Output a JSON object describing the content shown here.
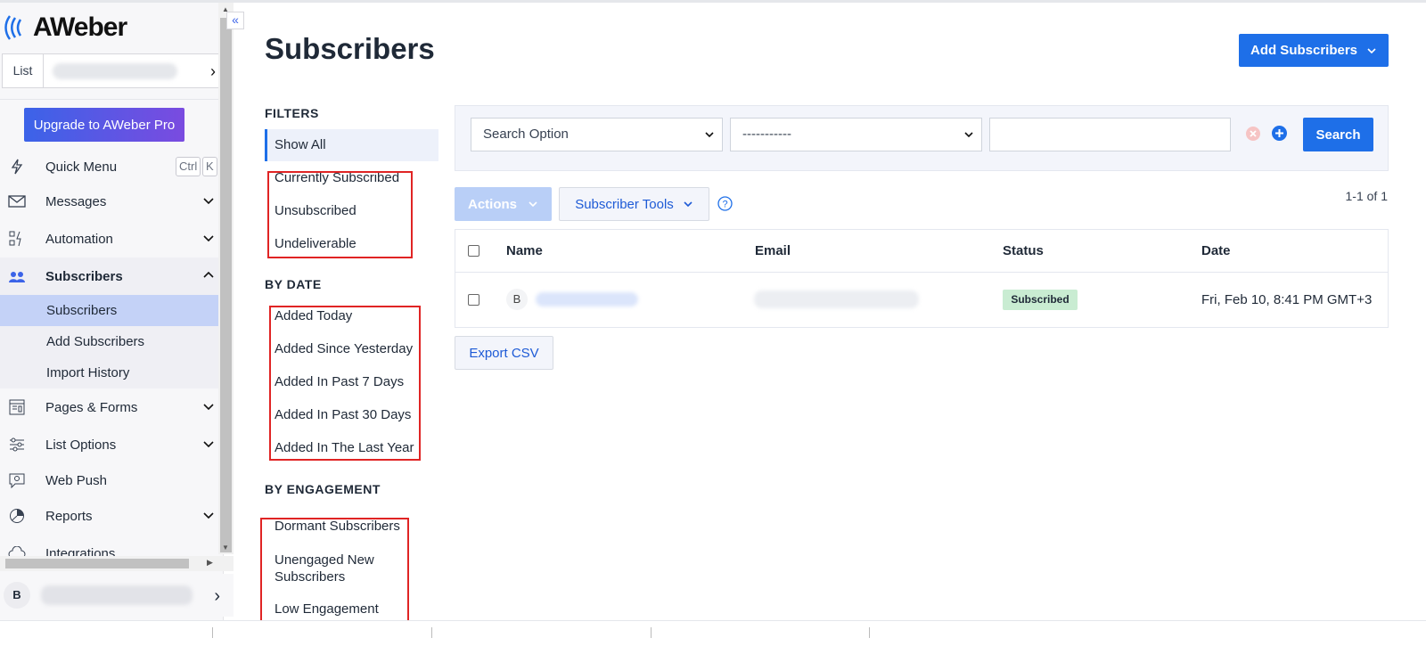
{
  "brand": {
    "logo_text": "AWeber"
  },
  "sidebar": {
    "list_label": "List",
    "upgrade_label": "Upgrade to AWeber Pro",
    "quick_menu": {
      "label": "Quick Menu",
      "kbd1": "Ctrl",
      "kbd2": "K"
    },
    "items": [
      {
        "label": "Messages",
        "icon": "envelope-icon"
      },
      {
        "label": "Automation",
        "icon": "automation-icon"
      },
      {
        "label": "Subscribers",
        "icon": "users-icon"
      },
      {
        "label": "Pages & Forms",
        "icon": "page-icon"
      },
      {
        "label": "List Options",
        "icon": "sliders-icon"
      },
      {
        "label": "Web Push",
        "icon": "push-icon"
      },
      {
        "label": "Reports",
        "icon": "pie-chart-icon"
      },
      {
        "label": "Integrations",
        "icon": "cloud-icon"
      }
    ],
    "subscribers_sub": [
      "Subscribers",
      "Add Subscribers",
      "Import History"
    ],
    "user_initial": "B"
  },
  "main": {
    "title": "Subscribers",
    "add_button": "Add Subscribers",
    "filters": {
      "heading": "FILTERS",
      "show_all": "Show All",
      "status_items": [
        "Currently Subscribed",
        "Unsubscribed",
        "Undeliverable"
      ],
      "by_date_heading": "BY DATE",
      "date_items": [
        "Added Today",
        "Added Since Yesterday",
        "Added In Past 7 Days",
        "Added In Past 30 Days",
        "Added In The Last Year"
      ],
      "by_engagement_heading": "BY ENGAGEMENT",
      "engagement_items": [
        "Dormant Subscribers",
        "Unengaged New Subscribers",
        "Low Engagement"
      ]
    },
    "search": {
      "option_select": "Search Option",
      "operator_select": "-----------",
      "button": "Search"
    },
    "toolbar": {
      "actions": "Actions",
      "subscriber_tools": "Subscriber Tools",
      "pager": "1-1 of 1"
    },
    "table": {
      "columns": [
        "Name",
        "Email",
        "Status",
        "Date"
      ],
      "rows": [
        {
          "initial": "B",
          "status": "Subscribed",
          "date": "Fri, Feb 10, 8:41 PM GMT+3"
        }
      ]
    },
    "export_label": "Export CSV"
  },
  "colors": {
    "accent": "#1e6fe8",
    "highlight": "#e02424",
    "badge": "#c9ecd2"
  }
}
